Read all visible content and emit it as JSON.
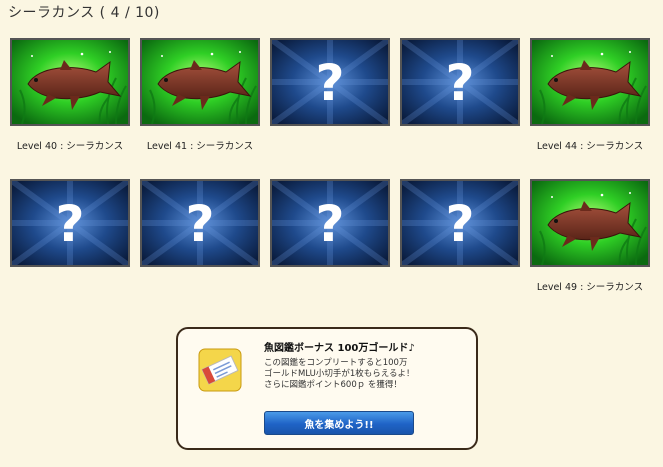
{
  "header": {
    "title": "シーラカンス ( 4 / 10)"
  },
  "cards": [
    {
      "state": "unlocked",
      "caption": "Level 40 : シーラカンス"
    },
    {
      "state": "unlocked",
      "caption": "Level 41 : シーラカンス"
    },
    {
      "state": "locked",
      "symbol": "?"
    },
    {
      "state": "locked",
      "symbol": "?"
    },
    {
      "state": "unlocked",
      "caption": "Level 44 : シーラカンス"
    },
    {
      "state": "locked",
      "symbol": "?"
    },
    {
      "state": "locked",
      "symbol": "?"
    },
    {
      "state": "locked",
      "symbol": "?"
    },
    {
      "state": "locked",
      "symbol": "?"
    },
    {
      "state": "unlocked",
      "caption": "Level 49 : シーラカンス"
    }
  ],
  "bonus": {
    "title": "魚図鑑ボーナス 100万ゴールド♪",
    "description_lines": [
      "この図鑑をコンプリートすると100万",
      "ゴールドMLU小切手が1枚もらえるよ！",
      "さらに図鑑ポイント600ｐ を獲得！"
    ],
    "button_label": "魚を集めよう!!",
    "icon": "gold-check-icon"
  },
  "colors": {
    "background": "#fbf6e2",
    "unlocked_bg": "#1fb11f",
    "locked_bg": "#102a55",
    "button": "#1f63c6"
  }
}
